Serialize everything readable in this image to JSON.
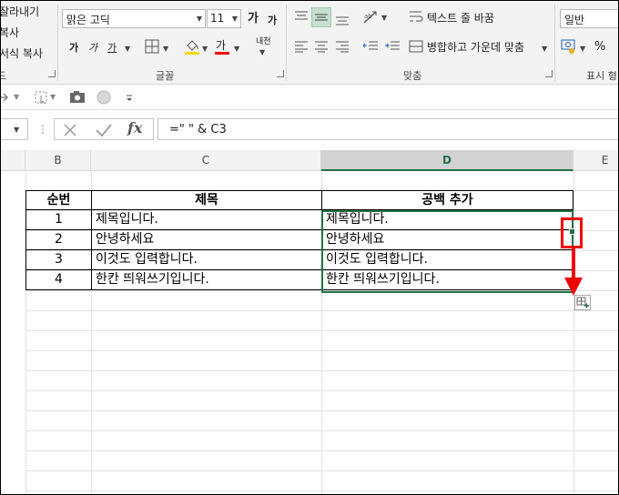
{
  "ribbon": {
    "clipboard": {
      "cut": "잘라내기",
      "copy": "복사",
      "format_painter": "서식 복사",
      "group_label": "드"
    },
    "font": {
      "name": "맑은 고딕",
      "size": "11",
      "grow": "가",
      "shrink": "가",
      "bold": "가",
      "italic": "가",
      "underline": "가",
      "font_color_glyph": "가",
      "phonetic": "내천",
      "group_label": "글꼴"
    },
    "alignment": {
      "wrap_text": "텍스트 줄 바꿈",
      "merge_center": "병합하고 가운데 맞춤",
      "group_label": "맞춤"
    },
    "number": {
      "format": "일반",
      "percent": "%",
      "group_label": "표시 형"
    }
  },
  "formula_bar": {
    "formula": "=\" \" & C3",
    "fx": "fx"
  },
  "columns": [
    "B",
    "C",
    "D",
    "E"
  ],
  "table": {
    "headers": [
      "순번",
      "제목",
      "공백 추가"
    ],
    "rows": [
      [
        "1",
        "제목입니다.",
        "제목입니다."
      ],
      [
        "2",
        "안녕하세요",
        "안녕하세요"
      ],
      [
        "3",
        "이것도 입력합니다.",
        "이것도 입력합니다."
      ],
      [
        "4",
        "한칸 띄워쓰기입니다.",
        "한칸 띄워쓰기입니다."
      ]
    ]
  },
  "colors": {
    "excel_green": "#217346",
    "highlight_red": "#e00000"
  }
}
